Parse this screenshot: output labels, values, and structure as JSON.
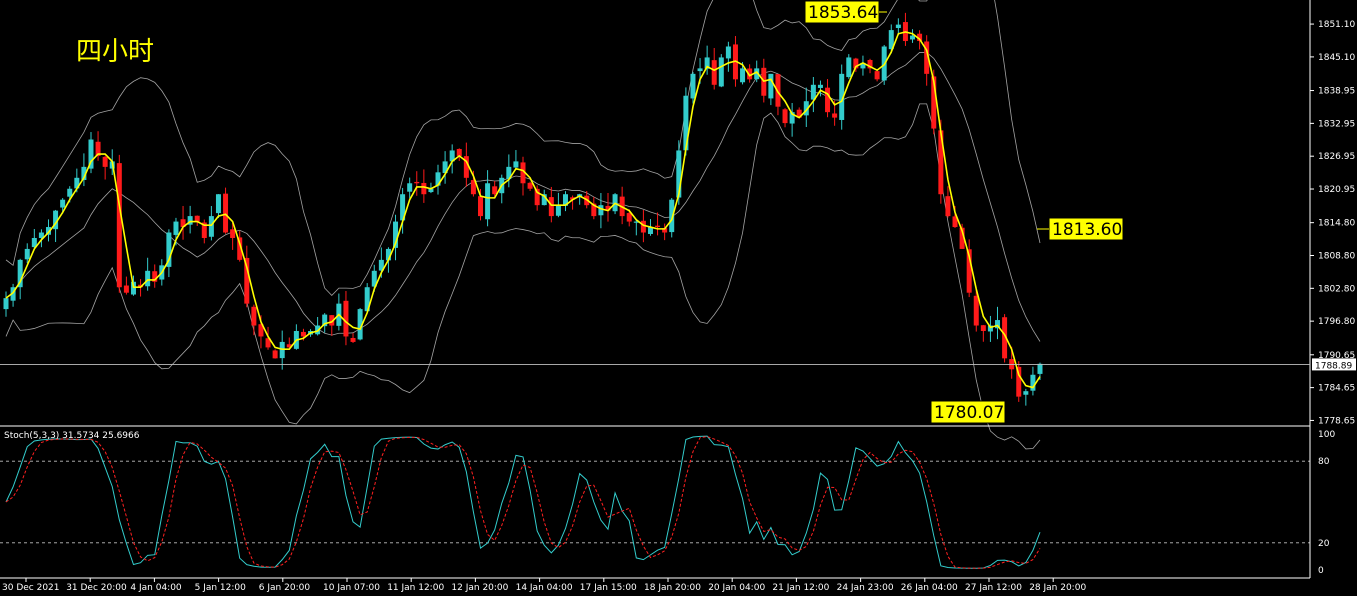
{
  "title": "四小时",
  "stoch_label": "Stoch(5,3,3) 31.5734 25.6966",
  "current_price": "1788.89",
  "annotations": {
    "high": "1853.64",
    "low": "1780.07",
    "target": "1813.60"
  },
  "price_ticks": [
    "1851.10",
    "1845.10",
    "1838.95",
    "1832.95",
    "1826.95",
    "1820.95",
    "1814.80",
    "1808.80",
    "1802.80",
    "1796.80",
    "1790.65",
    "1784.65",
    "1778.65"
  ],
  "stoch_ticks": [
    "100",
    "80",
    "20",
    "0"
  ],
  "date_labels": [
    "30 Dec 2021",
    "31 Dec 20:00",
    "4 Jan 04:00",
    "5 Jan 12:00",
    "6 Jan 20:00",
    "10 Jan 07:00",
    "11 Jan 12:00",
    "12 Jan 20:00",
    "14 Jan 04:00",
    "17 Jan 15:00",
    "18 Jan 20:00",
    "20 Jan 04:00",
    "21 Jan 12:00",
    "24 Jan 23:00",
    "26 Jan 04:00",
    "27 Jan 12:00",
    "28 Jan 20:00"
  ],
  "colors": {
    "background": "#000000",
    "bull_candle": "#33cccc",
    "bear_candle": "#ff1a1a",
    "ma_line": "#ffff00",
    "bands": "#bfbfbf",
    "stoch_main": "#33cccc",
    "stoch_signal": "#ff2020",
    "title": "#ffff00"
  },
  "chart_data": {
    "type": "candlestick",
    "indicators": [
      "Bollinger Bands",
      "Moving Average",
      "Stochastic(5,3,3)"
    ],
    "ylim": [
      1778.0,
      1855.5
    ],
    "closes": [
      1801,
      1803,
      1808,
      1810,
      1812,
      1813,
      1814,
      1817,
      1819,
      1821,
      1823,
      1825,
      1830,
      1827,
      1825,
      1826,
      1803,
      1802,
      1804,
      1803,
      1806,
      1804,
      1807,
      1813,
      1815,
      1814,
      1816,
      1815,
      1812,
      1816,
      1820,
      1813,
      1812,
      1808,
      1800,
      1796,
      1794,
      1792,
      1790,
      1793,
      1792,
      1795,
      1794,
      1795,
      1796,
      1798,
      1796,
      1800,
      1794,
      1793,
      1799,
      1803,
      1806,
      1808,
      1810,
      1815,
      1820,
      1822,
      1822,
      1820,
      1821,
      1824,
      1826,
      1828,
      1827,
      1823,
      1820,
      1816,
      1822,
      1820,
      1823,
      1825,
      1826,
      1822,
      1821,
      1818,
      1820,
      1816,
      1818,
      1820,
      1819,
      1820,
      1818,
      1816,
      1818,
      1817,
      1820,
      1816,
      1815,
      1815,
      1813,
      1814,
      1814,
      1813,
      1819,
      1828,
      1838,
      1842,
      1843,
      1845,
      1840,
      1845,
      1847,
      1841,
      1843,
      1841,
      1843,
      1838,
      1842,
      1836,
      1833,
      1835,
      1834,
      1837,
      1840,
      1840,
      1835,
      1834,
      1842,
      1845,
      1843,
      1844,
      1843,
      1841,
      1847,
      1850,
      1851,
      1848,
      1849,
      1848,
      1842,
      1832,
      1820,
      1816,
      1814,
      1810,
      1802,
      1796,
      1795,
      1796,
      1797,
      1790,
      1788,
      1783,
      1784,
      1787,
      1789
    ]
  }
}
